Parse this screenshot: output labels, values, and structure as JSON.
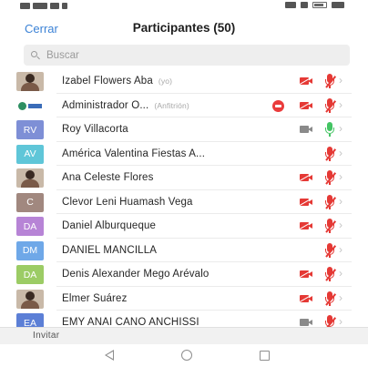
{
  "header": {
    "close_label": "Cerrar",
    "title": "Participantes (50)"
  },
  "search": {
    "placeholder": "Buscar"
  },
  "participants": [
    {
      "name": "Izabel Flowers Aba",
      "tag": "(yo)",
      "initials": "",
      "avatar_type": "photo",
      "avatar_color": "",
      "host": false,
      "video": "off",
      "audio": "off"
    },
    {
      "name": "Administrador O...",
      "tag": "(Anfitrión)",
      "initials": "",
      "avatar_type": "logo",
      "avatar_color": "",
      "host": true,
      "video": "off",
      "audio": "off"
    },
    {
      "name": "Roy Villacorta",
      "tag": "",
      "initials": "RV",
      "avatar_type": "initials",
      "avatar_color": "#7e8fd6",
      "host": false,
      "video": "on",
      "audio": "on"
    },
    {
      "name": "América Valentina Fiestas A...",
      "tag": "",
      "initials": "AV",
      "avatar_type": "initials",
      "avatar_color": "#5fc6d8",
      "host": false,
      "video": "none",
      "audio": "off"
    },
    {
      "name": "Ana Celeste Flores",
      "tag": "",
      "initials": "",
      "avatar_type": "photo",
      "avatar_color": "",
      "host": false,
      "video": "off",
      "audio": "off"
    },
    {
      "name": "Clevor Leni Huamash Vega",
      "tag": "",
      "initials": "C",
      "avatar_type": "initials",
      "avatar_color": "#a1887f",
      "host": false,
      "video": "off",
      "audio": "off"
    },
    {
      "name": "Daniel Alburqueque",
      "tag": "",
      "initials": "DA",
      "avatar_type": "initials",
      "avatar_color": "#b784d6",
      "host": false,
      "video": "off",
      "audio": "off"
    },
    {
      "name": "DANIEL MANCILLA",
      "tag": "",
      "initials": "DM",
      "avatar_type": "initials",
      "avatar_color": "#6fa8e8",
      "host": false,
      "video": "none",
      "audio": "off"
    },
    {
      "name": "Denis Alexander Mego Arévalo",
      "tag": "",
      "initials": "DA",
      "avatar_type": "initials",
      "avatar_color": "#9ccc65",
      "host": false,
      "video": "off",
      "audio": "off"
    },
    {
      "name": "Elmer Suárez",
      "tag": "",
      "initials": "",
      "avatar_type": "photo",
      "avatar_color": "",
      "host": false,
      "video": "off",
      "audio": "off"
    },
    {
      "name": "EMY ANAI CANO ANCHISSI",
      "tag": "",
      "initials": "EA",
      "avatar_type": "initials",
      "avatar_color": "#5c7fd6",
      "host": false,
      "video": "on",
      "audio": "off"
    }
  ],
  "footer": {
    "invite_label": "Invitar"
  },
  "icons": {
    "search": "search-icon",
    "video_off": "video-off-icon",
    "video_on": "video-on-icon",
    "mic_off": "mic-muted-icon",
    "mic_on": "mic-on-icon",
    "chevron": "chevron-right-icon",
    "host_badge": "record-icon"
  },
  "colors": {
    "accent": "#3b82d6",
    "muted_red": "#e53935",
    "active_green": "#43c463"
  }
}
